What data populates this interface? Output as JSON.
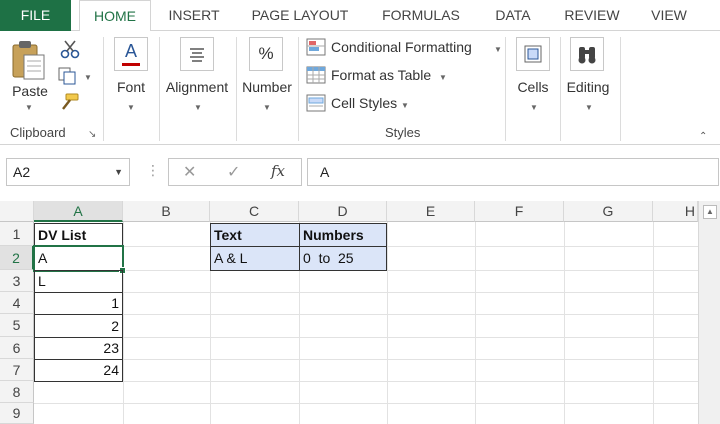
{
  "tabs": [
    {
      "label": "FILE"
    },
    {
      "label": "HOME"
    },
    {
      "label": "INSERT"
    },
    {
      "label": "PAGE LAYOUT"
    },
    {
      "label": "FORMULAS"
    },
    {
      "label": "DATA"
    },
    {
      "label": "REVIEW"
    },
    {
      "label": "VIEW"
    }
  ],
  "active_tab": "HOME",
  "ribbon": {
    "clipboard": {
      "paste": "Paste",
      "group": "Clipboard"
    },
    "font": {
      "label": "Font",
      "icon_glyph": "A"
    },
    "alignment": {
      "label": "Alignment"
    },
    "number": {
      "label": "Number",
      "icon_glyph": "%"
    },
    "styles": {
      "conditional": "Conditional Formatting",
      "format_table": "Format as Table",
      "cell_styles": "Cell Styles",
      "group": "Styles"
    },
    "cells": {
      "label": "Cells"
    },
    "editing": {
      "label": "Editing"
    }
  },
  "formula_bar": {
    "name_box": "A2",
    "cancel_glyph": "✕",
    "enter_glyph": "✓",
    "fx_glyph": "fx",
    "content": "A"
  },
  "grid": {
    "columns": [
      "A",
      "B",
      "C",
      "D",
      "E",
      "F",
      "G",
      "H"
    ],
    "rows": [
      "1",
      "2",
      "3",
      "4",
      "5",
      "6",
      "7",
      "8",
      "9"
    ],
    "selected_cell": "A2",
    "cells": {
      "A1": "DV List",
      "A2": "A",
      "A3": "L",
      "A4": "1",
      "A5": "2",
      "A6": "23",
      "A7": "24",
      "C1": "Text",
      "D1": "Numbers",
      "C2": "A & L",
      "D2": "0  to  25"
    }
  },
  "colors": {
    "accent": "#217346",
    "file_tab": "#1e7145",
    "highlight": "#dbe5f8"
  }
}
